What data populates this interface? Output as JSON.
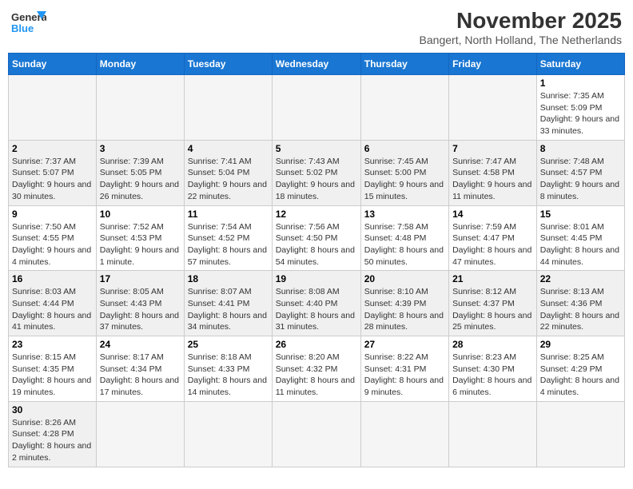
{
  "header": {
    "logo_text_general": "General",
    "logo_text_blue": "Blue",
    "month_title": "November 2025",
    "location": "Bangert, North Holland, The Netherlands"
  },
  "calendar": {
    "days_of_week": [
      "Sunday",
      "Monday",
      "Tuesday",
      "Wednesday",
      "Thursday",
      "Friday",
      "Saturday"
    ],
    "weeks": [
      {
        "days": [
          {
            "num": "",
            "info": ""
          },
          {
            "num": "",
            "info": ""
          },
          {
            "num": "",
            "info": ""
          },
          {
            "num": "",
            "info": ""
          },
          {
            "num": "",
            "info": ""
          },
          {
            "num": "",
            "info": ""
          },
          {
            "num": "1",
            "info": "Sunrise: 7:35 AM\nSunset: 5:09 PM\nDaylight: 9 hours\nand 33 minutes."
          }
        ]
      },
      {
        "days": [
          {
            "num": "2",
            "info": "Sunrise: 7:37 AM\nSunset: 5:07 PM\nDaylight: 9 hours\nand 30 minutes."
          },
          {
            "num": "3",
            "info": "Sunrise: 7:39 AM\nSunset: 5:05 PM\nDaylight: 9 hours\nand 26 minutes."
          },
          {
            "num": "4",
            "info": "Sunrise: 7:41 AM\nSunset: 5:04 PM\nDaylight: 9 hours\nand 22 minutes."
          },
          {
            "num": "5",
            "info": "Sunrise: 7:43 AM\nSunset: 5:02 PM\nDaylight: 9 hours\nand 18 minutes."
          },
          {
            "num": "6",
            "info": "Sunrise: 7:45 AM\nSunset: 5:00 PM\nDaylight: 9 hours\nand 15 minutes."
          },
          {
            "num": "7",
            "info": "Sunrise: 7:47 AM\nSunset: 4:58 PM\nDaylight: 9 hours\nand 11 minutes."
          },
          {
            "num": "8",
            "info": "Sunrise: 7:48 AM\nSunset: 4:57 PM\nDaylight: 9 hours\nand 8 minutes."
          }
        ]
      },
      {
        "days": [
          {
            "num": "9",
            "info": "Sunrise: 7:50 AM\nSunset: 4:55 PM\nDaylight: 9 hours\nand 4 minutes."
          },
          {
            "num": "10",
            "info": "Sunrise: 7:52 AM\nSunset: 4:53 PM\nDaylight: 9 hours\nand 1 minute."
          },
          {
            "num": "11",
            "info": "Sunrise: 7:54 AM\nSunset: 4:52 PM\nDaylight: 8 hours\nand 57 minutes."
          },
          {
            "num": "12",
            "info": "Sunrise: 7:56 AM\nSunset: 4:50 PM\nDaylight: 8 hours\nand 54 minutes."
          },
          {
            "num": "13",
            "info": "Sunrise: 7:58 AM\nSunset: 4:48 PM\nDaylight: 8 hours\nand 50 minutes."
          },
          {
            "num": "14",
            "info": "Sunrise: 7:59 AM\nSunset: 4:47 PM\nDaylight: 8 hours\nand 47 minutes."
          },
          {
            "num": "15",
            "info": "Sunrise: 8:01 AM\nSunset: 4:45 PM\nDaylight: 8 hours\nand 44 minutes."
          }
        ]
      },
      {
        "days": [
          {
            "num": "16",
            "info": "Sunrise: 8:03 AM\nSunset: 4:44 PM\nDaylight: 8 hours\nand 41 minutes."
          },
          {
            "num": "17",
            "info": "Sunrise: 8:05 AM\nSunset: 4:43 PM\nDaylight: 8 hours\nand 37 minutes."
          },
          {
            "num": "18",
            "info": "Sunrise: 8:07 AM\nSunset: 4:41 PM\nDaylight: 8 hours\nand 34 minutes."
          },
          {
            "num": "19",
            "info": "Sunrise: 8:08 AM\nSunset: 4:40 PM\nDaylight: 8 hours\nand 31 minutes."
          },
          {
            "num": "20",
            "info": "Sunrise: 8:10 AM\nSunset: 4:39 PM\nDaylight: 8 hours\nand 28 minutes."
          },
          {
            "num": "21",
            "info": "Sunrise: 8:12 AM\nSunset: 4:37 PM\nDaylight: 8 hours\nand 25 minutes."
          },
          {
            "num": "22",
            "info": "Sunrise: 8:13 AM\nSunset: 4:36 PM\nDaylight: 8 hours\nand 22 minutes."
          }
        ]
      },
      {
        "days": [
          {
            "num": "23",
            "info": "Sunrise: 8:15 AM\nSunset: 4:35 PM\nDaylight: 8 hours\nand 19 minutes."
          },
          {
            "num": "24",
            "info": "Sunrise: 8:17 AM\nSunset: 4:34 PM\nDaylight: 8 hours\nand 17 minutes."
          },
          {
            "num": "25",
            "info": "Sunrise: 8:18 AM\nSunset: 4:33 PM\nDaylight: 8 hours\nand 14 minutes."
          },
          {
            "num": "26",
            "info": "Sunrise: 8:20 AM\nSunset: 4:32 PM\nDaylight: 8 hours\nand 11 minutes."
          },
          {
            "num": "27",
            "info": "Sunrise: 8:22 AM\nSunset: 4:31 PM\nDaylight: 8 hours\nand 9 minutes."
          },
          {
            "num": "28",
            "info": "Sunrise: 8:23 AM\nSunset: 4:30 PM\nDaylight: 8 hours\nand 6 minutes."
          },
          {
            "num": "29",
            "info": "Sunrise: 8:25 AM\nSunset: 4:29 PM\nDaylight: 8 hours\nand 4 minutes."
          }
        ]
      },
      {
        "days": [
          {
            "num": "30",
            "info": "Sunrise: 8:26 AM\nSunset: 4:28 PM\nDaylight: 8 hours\nand 2 minutes."
          },
          {
            "num": "",
            "info": ""
          },
          {
            "num": "",
            "info": ""
          },
          {
            "num": "",
            "info": ""
          },
          {
            "num": "",
            "info": ""
          },
          {
            "num": "",
            "info": ""
          },
          {
            "num": "",
            "info": ""
          }
        ]
      }
    ]
  }
}
